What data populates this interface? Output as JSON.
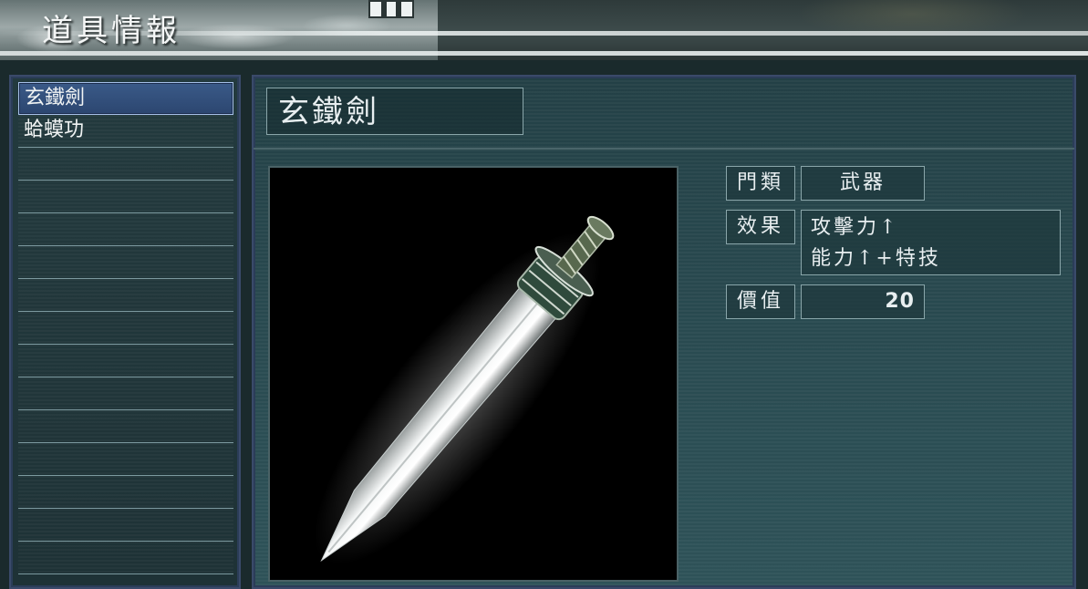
{
  "header": {
    "title": "道具情報"
  },
  "item_list": [
    {
      "label": "玄鐵劍",
      "selected": true
    },
    {
      "label": "蛤蟆功",
      "selected": false
    },
    {
      "label": ""
    },
    {
      "label": ""
    },
    {
      "label": ""
    },
    {
      "label": ""
    },
    {
      "label": ""
    },
    {
      "label": ""
    },
    {
      "label": ""
    },
    {
      "label": ""
    },
    {
      "label": ""
    },
    {
      "label": ""
    },
    {
      "label": ""
    },
    {
      "label": ""
    },
    {
      "label": ""
    }
  ],
  "detail": {
    "name": "玄鐵劍",
    "image_icon": "sword-image",
    "category_label": "門類",
    "category_value": "武器",
    "effect_label": "效果",
    "effect_lines": [
      "攻擊力↑",
      "能力↑+特技"
    ],
    "price_label": "價值",
    "price_value": "20"
  },
  "colors": {
    "selection": "#2c4670",
    "panel_border": "#3a4a6a",
    "field_border": "#8aa6aa"
  }
}
